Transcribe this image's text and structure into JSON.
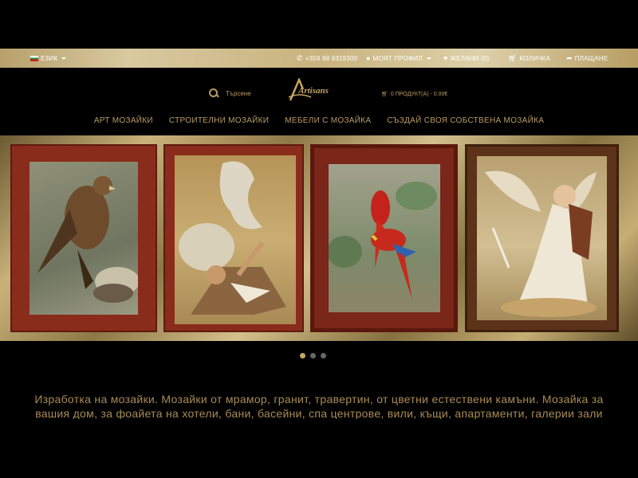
{
  "topbar": {
    "language": "ЕЗИК",
    "phone": "+359 88 9319300",
    "profile": "МОЯТ ПРОФИЛ",
    "wishlist": "ЖЕЛАНИ (0)",
    "cart": "КОЛИЧКА",
    "checkout": "ПЛАЩАНЕ"
  },
  "header": {
    "search_placeholder": "Търсене",
    "logo_text": "Artisans",
    "cart_summary": "0 ПРОДУКТ(А) - 0.00€"
  },
  "nav": [
    "АРТ МОЗАЙКИ",
    "СТРОИТЕЛНИ МОЗАЙКИ",
    "МЕБЕЛИ С МОЗАЙКА",
    "СЪЗДАЙ СВОЯ СОБСТВЕНА МОЗАЙКА"
  ],
  "slider": {
    "slides_count": 3,
    "active_slide": 1,
    "images": [
      "hawk-mosaic",
      "man-and-horse-mosaic",
      "parrots-mosaic",
      "angel-mosaic"
    ]
  },
  "description": "Изработка на мозайки. Мозайки от мрамор, гранит, травертин, от цветни естествени камъни. Мозайка за вашия дом, за фоайета на хотели, бани, басейни, спа центрове, вили, къщи, апартаменти, галерии зали за",
  "colors": {
    "gold": "#b99c64",
    "frame": "#8a2a1a",
    "background": "#000000"
  }
}
